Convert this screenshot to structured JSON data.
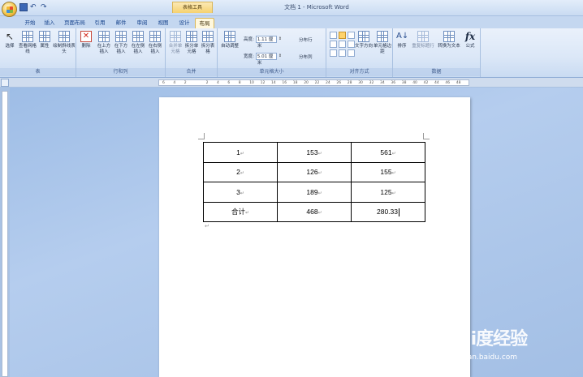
{
  "window": {
    "title": "文档 1 - Microsoft Word",
    "context_tab_title": "表格工具"
  },
  "tabs": [
    "开始",
    "插入",
    "页面布局",
    "引用",
    "邮件",
    "审阅",
    "视图",
    "设计",
    "布局"
  ],
  "active_tab": "布局",
  "ribbon": {
    "groups": {
      "table": {
        "label": "表",
        "buttons": [
          "选择",
          "查看网格线",
          "属性",
          "绘制斜线表头"
        ]
      },
      "rows_cols": {
        "label": "行和列",
        "buttons": [
          "删除",
          "在上方插入",
          "在下方插入",
          "在左侧插入",
          "在右侧插入"
        ]
      },
      "merge": {
        "label": "合并",
        "buttons": [
          "合并单元格",
          "拆分单元格",
          "拆分表格"
        ]
      },
      "cell_size": {
        "label": "单元格大小",
        "autofit": "自动调整",
        "height_label": "高度:",
        "height_value": "1.11 厘米",
        "width_label": "宽度:",
        "width_value": "5.01 厘米",
        "distribute_rows": "分布行",
        "distribute_cols": "分布列"
      },
      "alignment": {
        "label": "对齐方式",
        "text_direction": "文字方向",
        "cell_margins": "单元格边距"
      },
      "data": {
        "label": "数据",
        "sort": "排序",
        "repeat_header": "重复标题行",
        "convert_to_text": "转换为文本",
        "formula": "公式"
      }
    }
  },
  "ruler_ticks": [
    "6",
    "4",
    "2",
    "",
    "2",
    "4",
    "6",
    "8",
    "10",
    "12",
    "14",
    "16",
    "18",
    "20",
    "22",
    "24",
    "26",
    "28",
    "30",
    "32",
    "34",
    "36",
    "38",
    "40",
    "42",
    "44",
    "46",
    "48"
  ],
  "document": {
    "table": [
      [
        "1",
        "153",
        "561"
      ],
      [
        "2",
        "126",
        "155"
      ],
      [
        "3",
        "189",
        "125"
      ],
      [
        "合计",
        "468",
        "280.33"
      ]
    ],
    "paragraph_mark": "↵"
  },
  "watermark": {
    "brand": "Bai度经验",
    "url": "jingyan.baidu.com"
  }
}
